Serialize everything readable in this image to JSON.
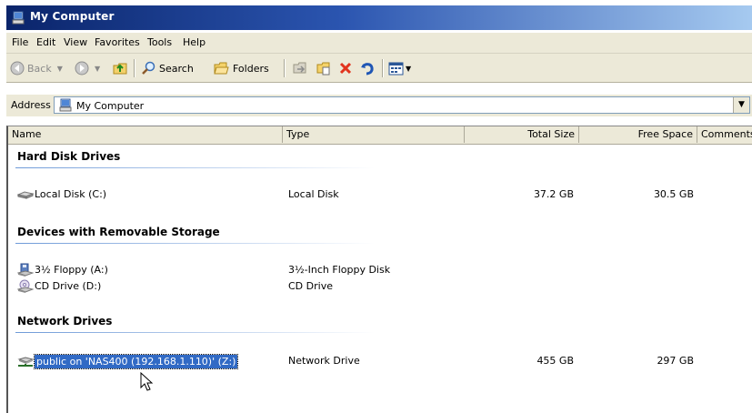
{
  "window": {
    "title": "My Computer"
  },
  "menu": [
    "File",
    "Edit",
    "View",
    "Favorites",
    "Tools",
    "Help"
  ],
  "toolbar": {
    "back": "Back",
    "search": "Search",
    "folders": "Folders"
  },
  "address": {
    "label": "Address",
    "value": "My Computer"
  },
  "columns": [
    "Name",
    "Type",
    "Total Size",
    "Free Space",
    "Comments"
  ],
  "groups": [
    {
      "title": "Hard Disk Drives",
      "items": [
        {
          "icon": "hard-disk-icon",
          "name": "Local Disk (C:)",
          "type": "Local Disk",
          "total": "37.2 GB",
          "free": "30.5 GB"
        }
      ]
    },
    {
      "title": "Devices with Removable Storage",
      "items": [
        {
          "icon": "floppy-icon",
          "name": "3½ Floppy (A:)",
          "type": "3½-Inch Floppy Disk",
          "total": "",
          "free": ""
        },
        {
          "icon": "cd-drive-icon",
          "name": "CD Drive (D:)",
          "type": "CD Drive",
          "total": "",
          "free": ""
        }
      ]
    },
    {
      "title": "Network Drives",
      "items": [
        {
          "icon": "network-drive-icon",
          "name": "public on 'NAS400 (192.168.1.110)' (Z:)",
          "type": "Network Drive",
          "total": "455 GB",
          "free": "297 GB",
          "selected": true
        }
      ]
    }
  ]
}
